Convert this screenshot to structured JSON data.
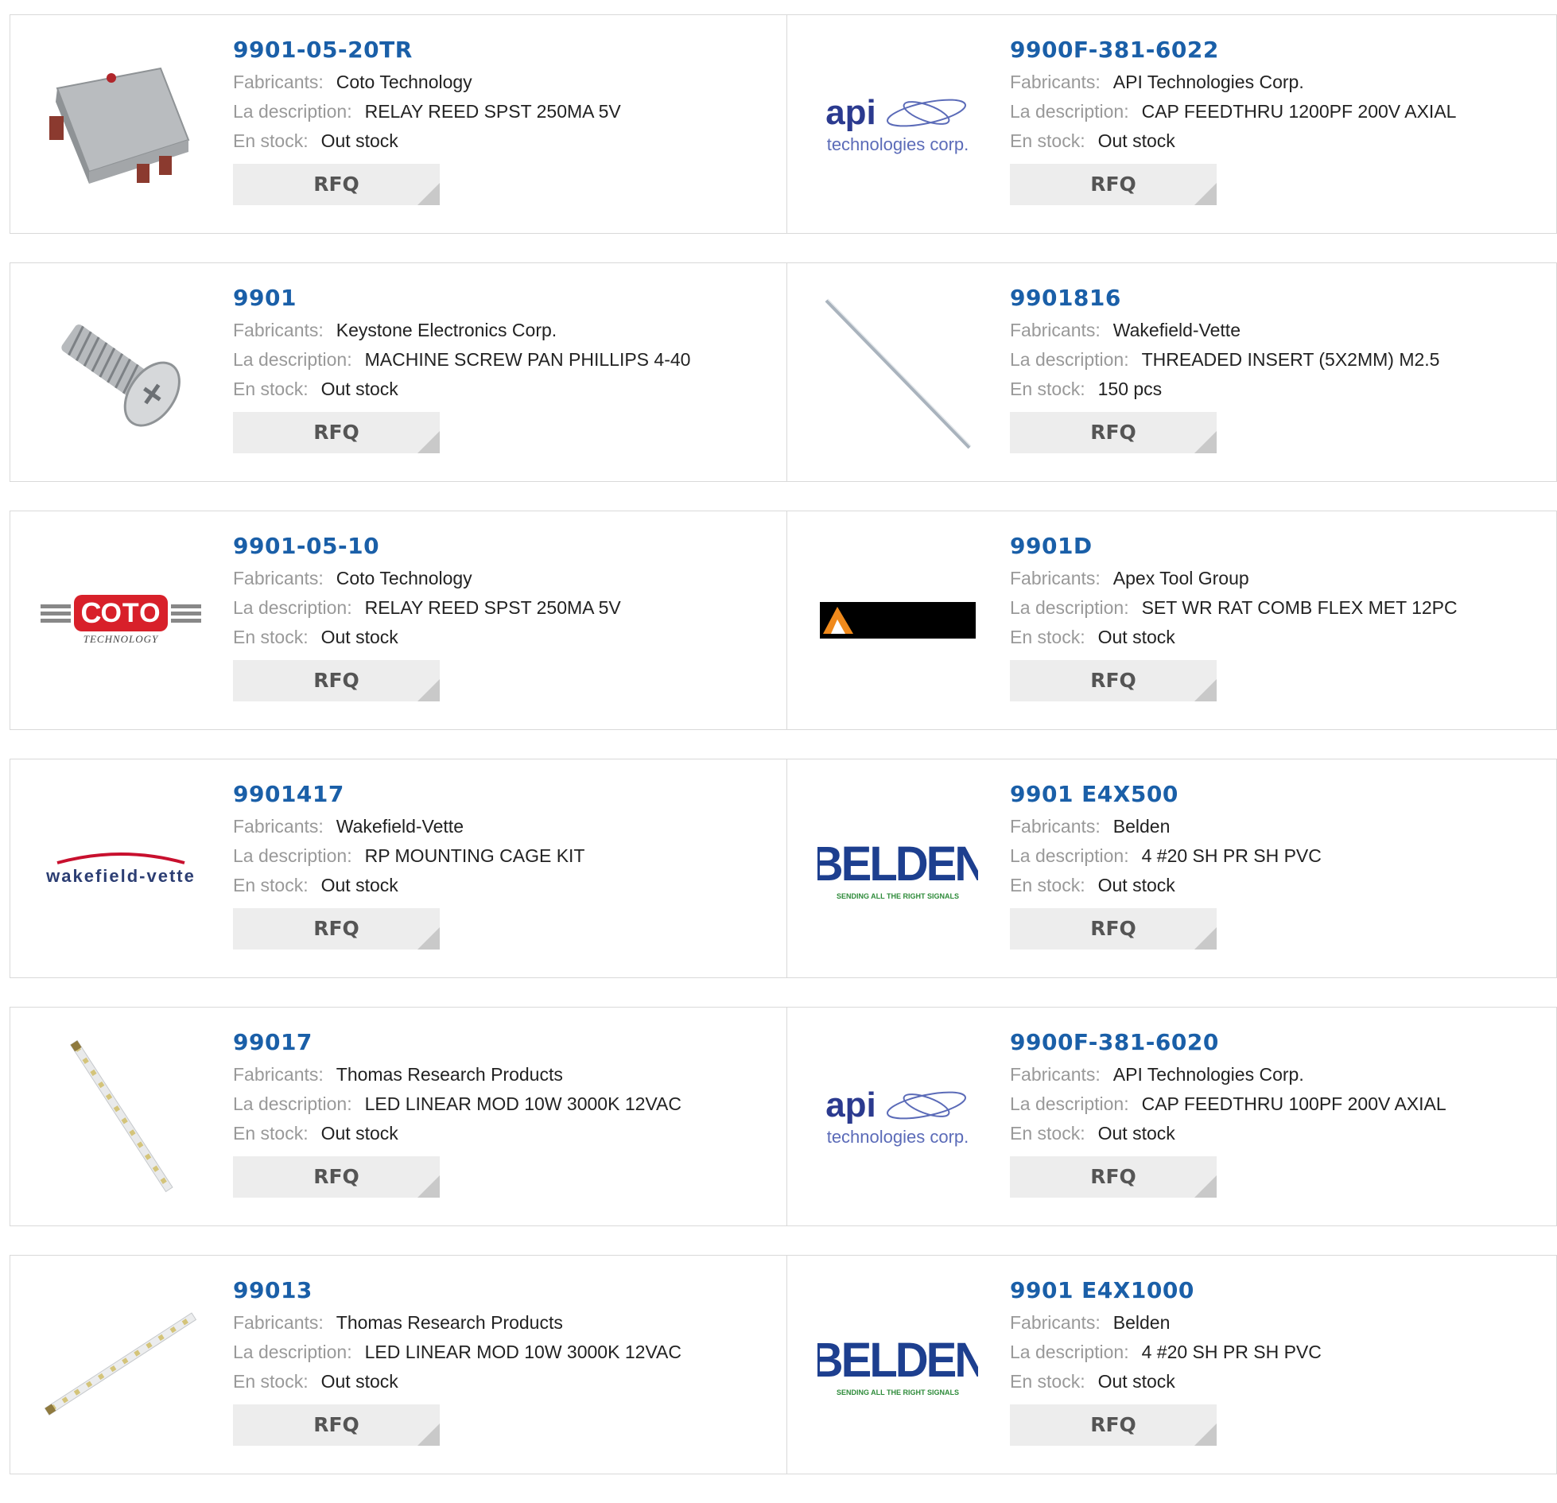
{
  "labels": {
    "manufacturer": "Fabricants:",
    "description": "La description:",
    "stock": "En stock:",
    "rfq": "RFQ"
  },
  "products": [
    {
      "part": "9901-05-20TR",
      "manufacturer": "Coto Technology",
      "description": "RELAY REED SPST 250MA 5V",
      "stock": "Out stock",
      "image": "relay-image"
    },
    {
      "part": "9900F-381-6022",
      "manufacturer": "API Technologies Corp.",
      "description": "CAP FEEDTHRU 1200PF 200V AXIAL",
      "stock": "Out stock",
      "image": "api-logo",
      "logo_text": [
        "api",
        "technologies corp."
      ]
    },
    {
      "part": "9901",
      "manufacturer": "Keystone Electronics Corp.",
      "description": "MACHINE SCREW PAN PHILLIPS 4-40",
      "stock": "Out stock",
      "image": "screw-image"
    },
    {
      "part": "9901816",
      "manufacturer": "Wakefield-Vette",
      "description": "THREADED INSERT (5X2MM) M2.5",
      "stock": "150 pcs",
      "image": "rod-image"
    },
    {
      "part": "9901-05-10",
      "manufacturer": "Coto Technology",
      "description": "RELAY REED SPST 250MA 5V",
      "stock": "Out stock",
      "image": "coto-logo",
      "logo_text": [
        "OTO",
        "TECHNOLOGY"
      ]
    },
    {
      "part": "9901D",
      "manufacturer": "Apex Tool Group",
      "description": "SET WR RAT COMB FLEX MET 12PC",
      "stock": "Out stock",
      "image": "apex-logo"
    },
    {
      "part": "9901417",
      "manufacturer": "Wakefield-Vette",
      "description": "RP MOUNTING CAGE KIT",
      "stock": "Out stock",
      "image": "wakefield-logo",
      "logo_text": [
        "wakefield-vette"
      ]
    },
    {
      "part": "9901 E4X500",
      "manufacturer": "Belden",
      "description": "4 #20 SH PR SH PVC",
      "stock": "Out stock",
      "image": "belden-logo",
      "logo_text": [
        "BELDEN",
        "SENDING ALL THE RIGHT SIGNALS"
      ]
    },
    {
      "part": "99017",
      "manufacturer": "Thomas Research Products",
      "description": "LED LINEAR MOD 10W 3000K 12VAC",
      "stock": "Out stock",
      "image": "led-strip-image"
    },
    {
      "part": "9900F-381-6020",
      "manufacturer": "API Technologies Corp.",
      "description": "CAP FEEDTHRU 100PF 200V AXIAL",
      "stock": "Out stock",
      "image": "api-logo",
      "logo_text": [
        "api",
        "technologies corp."
      ]
    },
    {
      "part": "99013",
      "manufacturer": "Thomas Research Products",
      "description": "LED LINEAR MOD 10W 3000K 12VAC",
      "stock": "Out stock",
      "image": "led-strip-image-2"
    },
    {
      "part": "9901 E4X1000",
      "manufacturer": "Belden",
      "description": "4 #20 SH PR SH PVC",
      "stock": "Out stock",
      "image": "belden-logo",
      "logo_text": [
        "BELDEN",
        "SENDING ALL THE RIGHT SIGNALS"
      ]
    }
  ],
  "colors": {
    "part_number": "#1a5fa8",
    "label": "#999999",
    "rfq_bg": "#ededed",
    "border": "#d9d9d9",
    "api_blue": "#2b3a8f",
    "coto_red": "#d8202a",
    "belden_blue": "#1d3f8f",
    "wakefield_red": "#c8102e"
  }
}
